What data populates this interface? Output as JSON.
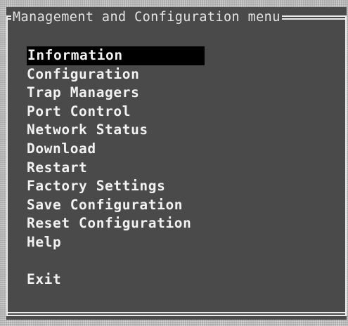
{
  "window": {
    "title": "Management and Configuration menu"
  },
  "menu": {
    "items": [
      {
        "label": "Information",
        "selected": true
      },
      {
        "label": "Configuration",
        "selected": false
      },
      {
        "label": "Trap Managers",
        "selected": false
      },
      {
        "label": "Port Control",
        "selected": false
      },
      {
        "label": "Network Status",
        "selected": false
      },
      {
        "label": "Download",
        "selected": false
      },
      {
        "label": "Restart",
        "selected": false
      },
      {
        "label": "Factory Settings",
        "selected": false
      },
      {
        "label": "Save Configuration",
        "selected": false
      },
      {
        "label": "Reset Configuration",
        "selected": false
      },
      {
        "label": "Help",
        "selected": false
      }
    ],
    "exit_label": "Exit"
  },
  "colors": {
    "panel_background": "#4a4a4a",
    "text": "#f2f2f2",
    "selection_background": "#000000",
    "border": "#ececec",
    "desktop_background": "#b9b9b9"
  }
}
